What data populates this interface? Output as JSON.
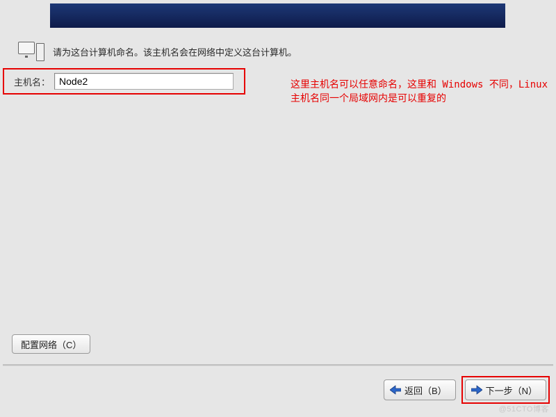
{
  "header": {},
  "instruction": "请为这台计算机命名。该主机名会在网络中定义这台计算机。",
  "hostname": {
    "label": "主机名：",
    "value": "Node2"
  },
  "annotation": "这里主机名可以任意命名，这里和 Windows 不同，Linux 主机名同一个局域网内是可以重复的",
  "buttons": {
    "configure_network": "配置网络（C）",
    "back": "返回（B）",
    "next": "下一步（N）"
  },
  "watermark": "@51CTO博客"
}
